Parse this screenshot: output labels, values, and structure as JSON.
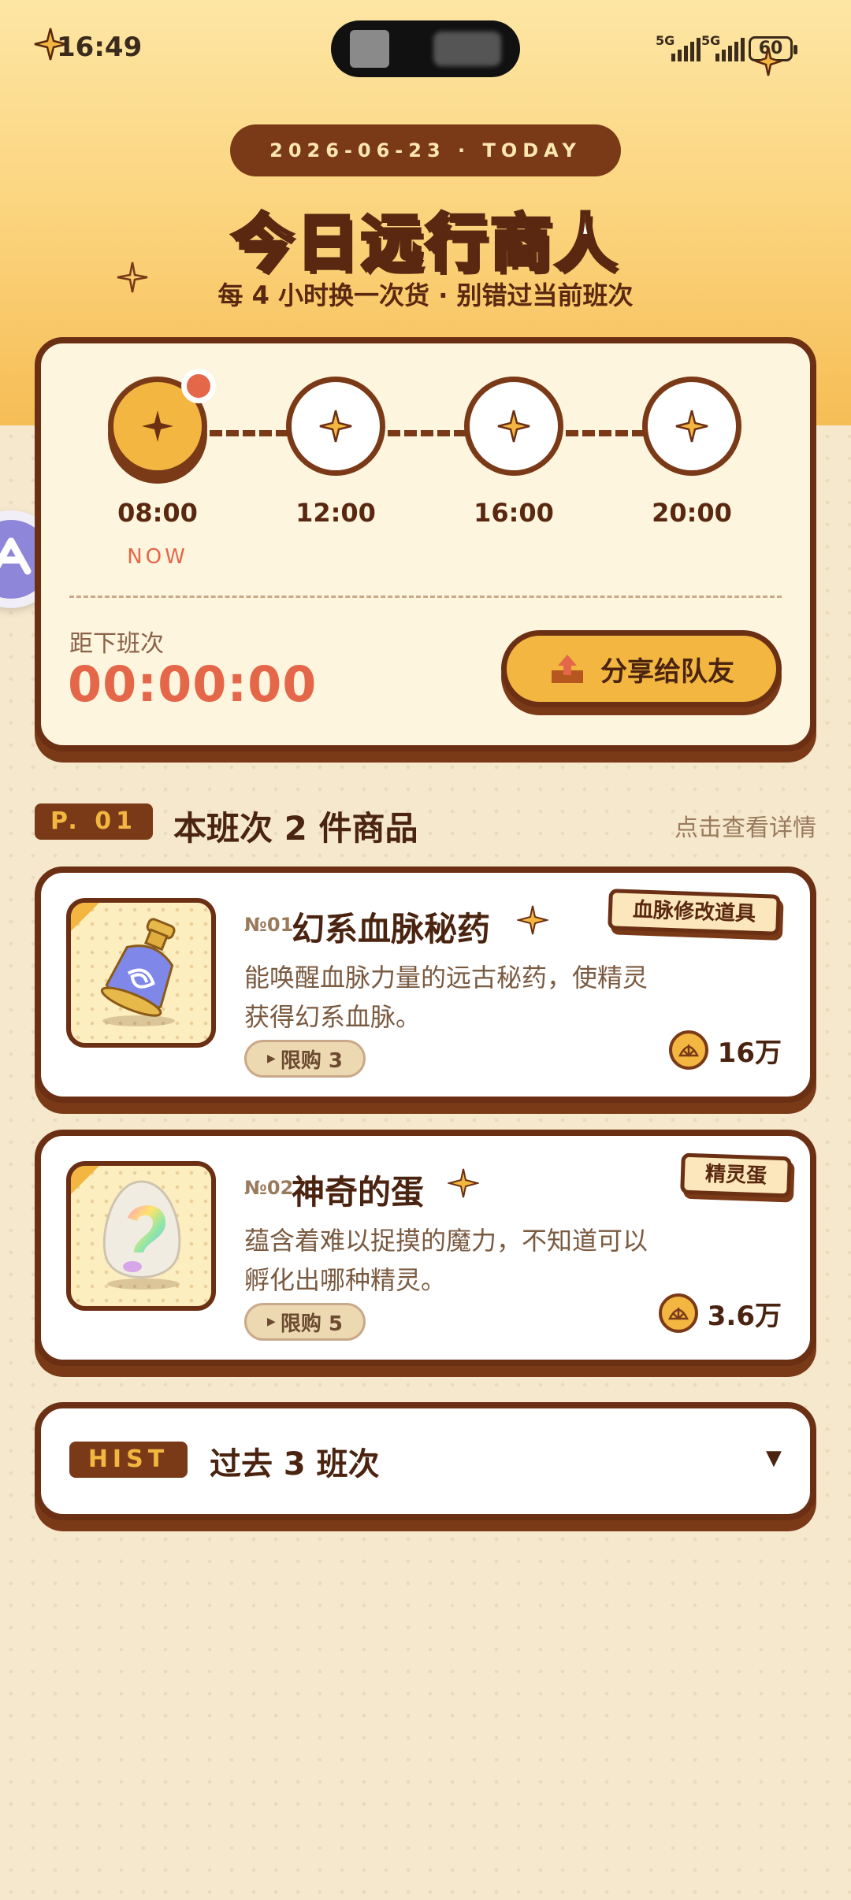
{
  "status_bar": {
    "time": "16:49",
    "network_1": "5G",
    "network_2": "5G",
    "battery": "60"
  },
  "header": {
    "date_pill": "2026-06-23 · TODAY",
    "title": "今日远行商人",
    "subtitle": "每 4 小时换一次货 · 别错过当前班次"
  },
  "schedule": {
    "slots": [
      {
        "time": "08:00",
        "active": true
      },
      {
        "time": "12:00",
        "active": false
      },
      {
        "time": "16:00",
        "active": false
      },
      {
        "time": "20:00",
        "active": false
      }
    ],
    "now_label": "NOW",
    "next_label": "距下班次",
    "countdown": "00:00:00",
    "share_label": "分享给队友"
  },
  "section": {
    "badge": "P. 01",
    "title": "本班次 2 件商品",
    "detail_link": "点击查看详情"
  },
  "items": [
    {
      "no": "№01",
      "name": "幻系血脉秘药",
      "tag": "血脉修改道具",
      "desc_line1": "能唤醒血脉力量的远古秘药，使精灵",
      "desc_line2": "获得幻系血脉。",
      "limit": "限购 3",
      "price": "16万",
      "icon": "potion-icon"
    },
    {
      "no": "№02",
      "name": "神奇的蛋",
      "tag": "精灵蛋",
      "desc_line1": "蕴含着难以捉摸的魔力，不知道可以",
      "desc_line2": "孵化出哪种精灵。",
      "limit": "限购 5",
      "price": "3.6万",
      "icon": "egg-icon"
    }
  ],
  "history": {
    "badge": "HIST",
    "title": "过去 3 班次",
    "caret": "▼"
  },
  "colors": {
    "brown": "#6b2f14",
    "gold": "#f3b640",
    "accent_red": "#e4674a",
    "cream": "#fdf5de",
    "background": "#f5e8cd"
  }
}
